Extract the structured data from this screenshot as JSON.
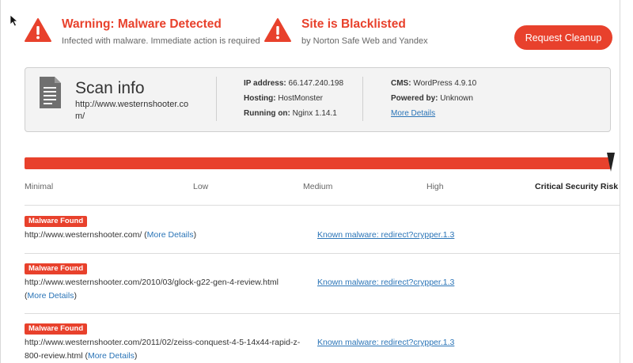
{
  "alerts": [
    {
      "icon": "warning-triangle-icon",
      "title": "Warning: Malware Detected",
      "subtitle": "Infected with malware. Immediate action is required"
    },
    {
      "icon": "warning-triangle-icon",
      "title": "Site is Blacklisted",
      "subtitle": "by Norton Safe Web and Yandex"
    }
  ],
  "cleanup_button": "Request Cleanup",
  "scan_info": {
    "icon": "document-icon",
    "title": "Scan info",
    "url_line1": "http://www.westernshooter.co",
    "url_line2": "m/",
    "ip_label": "IP address:",
    "ip_value": "66.147.240.198",
    "hosting_label": "Hosting:",
    "hosting_value": "HostMonster",
    "running_label": "Running on:",
    "running_value": "Nginx 1.14.1",
    "cms_label": "CMS:",
    "cms_value": "WordPress 4.9.10",
    "powered_label": "Powered by:",
    "powered_value": "Unknown",
    "more_details": "More Details"
  },
  "risk": {
    "level_index": 4,
    "labels": [
      "Minimal",
      "Low",
      "Medium",
      "High",
      "Critical Security Risk"
    ]
  },
  "findings": [
    {
      "badge": "Malware Found",
      "url": "http://www.westernshooter.com/",
      "more_open": "(",
      "more": "More Details",
      "more_close": ")",
      "malware": "Known malware: redirect?crypper.1.3"
    },
    {
      "badge": "Malware Found",
      "url": "http://www.westernshooter.com/2010/03/glock-g22-gen-4-review.html",
      "more_open": "(",
      "more": "More Details",
      "more_close": ")",
      "malware": "Known malware: redirect?crypper.1.3"
    },
    {
      "badge": "Malware Found",
      "url": "http://www.westernshooter.com/2011/02/zeiss-conquest-4-5-14x44-rapid-z-800-review.html",
      "more_open": "(",
      "more": "More Details",
      "more_close": ")",
      "malware": "Known malware: redirect?crypper.1.3"
    }
  ],
  "colors": {
    "accent": "#e8412c",
    "link": "#2a74b7",
    "card_bg": "#f3f3f3"
  }
}
